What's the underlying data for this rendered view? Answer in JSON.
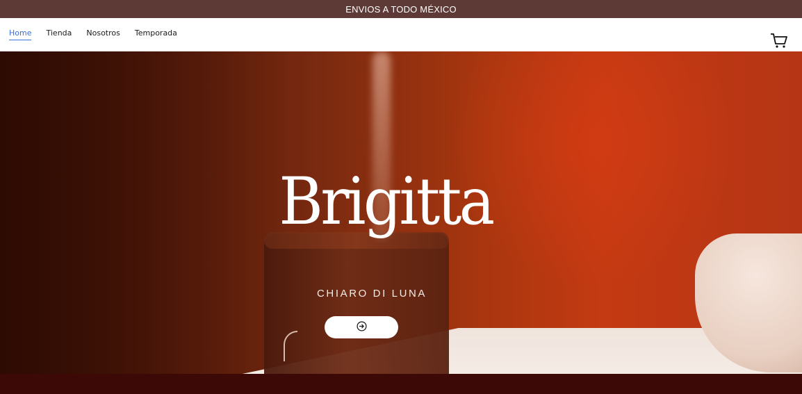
{
  "announcement": {
    "text": "ENVIOS A TODO MÉXICO"
  },
  "nav": {
    "items": [
      {
        "label": "Home",
        "active": true
      },
      {
        "label": "Tienda",
        "active": false
      },
      {
        "label": "Nosotros",
        "active": false
      },
      {
        "label": "Temporada",
        "active": false
      }
    ]
  },
  "header": {
    "cart_icon": "shopping-cart-icon"
  },
  "hero": {
    "brand": "Brigitta",
    "subtitle": "CHIARO DI LUNA",
    "cta_icon": "arrow-right-circle-icon"
  },
  "colors": {
    "announcement_bg": "#5e3a37",
    "nav_active": "#3b6fd6",
    "hero_red": "#c43a12",
    "footer_band": "#3d0907"
  }
}
